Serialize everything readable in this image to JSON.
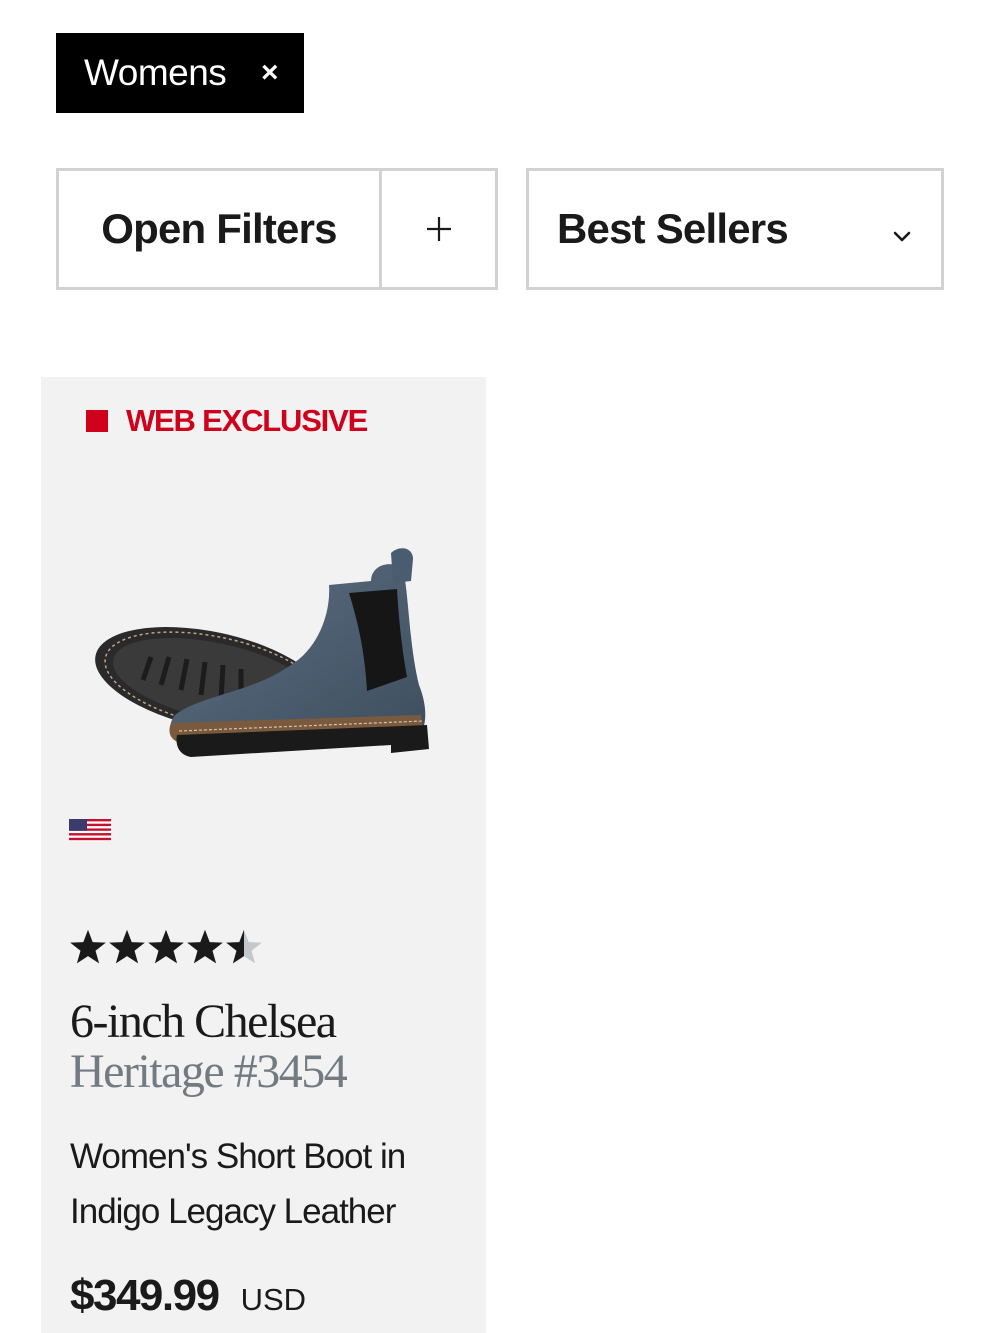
{
  "active_filter": {
    "label": "Womens",
    "remove_icon": "close-icon",
    "remove_glyph": "×"
  },
  "controls": {
    "filters_label": "Open Filters",
    "filters_icon": "plus-icon",
    "sort_label": "Best Sellers",
    "sort_icon": "chevron-down-icon"
  },
  "products": [
    {
      "badge": "WEB EXCLUSIVE",
      "badge_color": "#d0021b",
      "image": "chelsea-boot-indigo-image",
      "origin_flag": "us-flag-icon",
      "rating": 4.5,
      "rating_max": 5,
      "name": "6-inch Chelsea",
      "model": "Heritage #3454",
      "description": "Women's Short Boot in Indigo Legacy Leather",
      "price": "$349.99",
      "currency": "USD"
    }
  ],
  "colors": {
    "chip_background": "#000000",
    "border": "#d2d2d2",
    "card_background": "#f2f2f2",
    "accent_red": "#d0021b",
    "model_gray": "#727a82"
  }
}
